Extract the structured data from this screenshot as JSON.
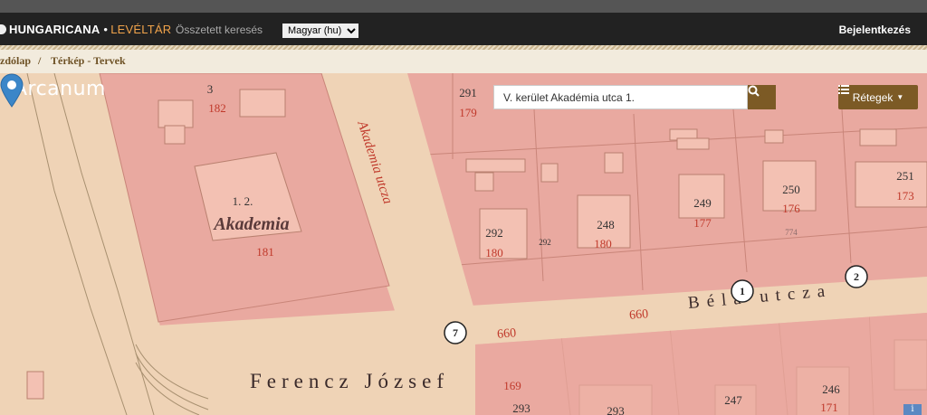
{
  "header": {
    "brand": "HUNGARICANA",
    "brand_separator": "•",
    "brand_section": "LEVÉLTÁR",
    "advanced_search": "Összetett keresés",
    "language_selected": "Magyar (hu)",
    "login": "Bejelentkezés"
  },
  "breadcrumb": {
    "items": [
      "zdólap",
      "Térkép - Tervek"
    ],
    "separator": "/"
  },
  "map": {
    "watermark": "Arcanum",
    "search_value": "V. kerület Akadémia utca 1.",
    "layers_label": "Rétegek",
    "info_label": "i",
    "labels": {
      "lot_3": "3",
      "lot_182": "182",
      "lot_12": "1. 2.",
      "akademia": "Akademia",
      "lot_181": "181",
      "akademia_utca": "Akademia utcza",
      "lot_291": "291",
      "lot_179": "179",
      "lot_292": "292",
      "lot_180": "180",
      "lot_292_small": "292",
      "lot_248": "248",
      "lot_180b": "180",
      "lot_249": "249",
      "lot_177": "177",
      "lot_250": "250",
      "lot_176": "176",
      "lot_774": "774",
      "lot_251": "251",
      "lot_173": "173",
      "lot_660a": "660",
      "bela_utcza": "Béla utcza",
      "circle_1": "1",
      "circle_2": "2",
      "circle_7": "7",
      "lot_660b": "660",
      "ferencz_jozsef": "Ferencz József",
      "lot_169": "169",
      "lot_293": "293",
      "lot_293b": "293",
      "lot_247": "247",
      "lot_246": "246",
      "lot_171": "171"
    },
    "colors": {
      "lot_pink": "#e9a9a0",
      "street_beige": "#efd3b6",
      "building_pink": "#f3c1b3",
      "lot_number_red": "#c0392b",
      "button_brown": "#7c5a25",
      "marker_blue": "#3b86c8"
    }
  }
}
